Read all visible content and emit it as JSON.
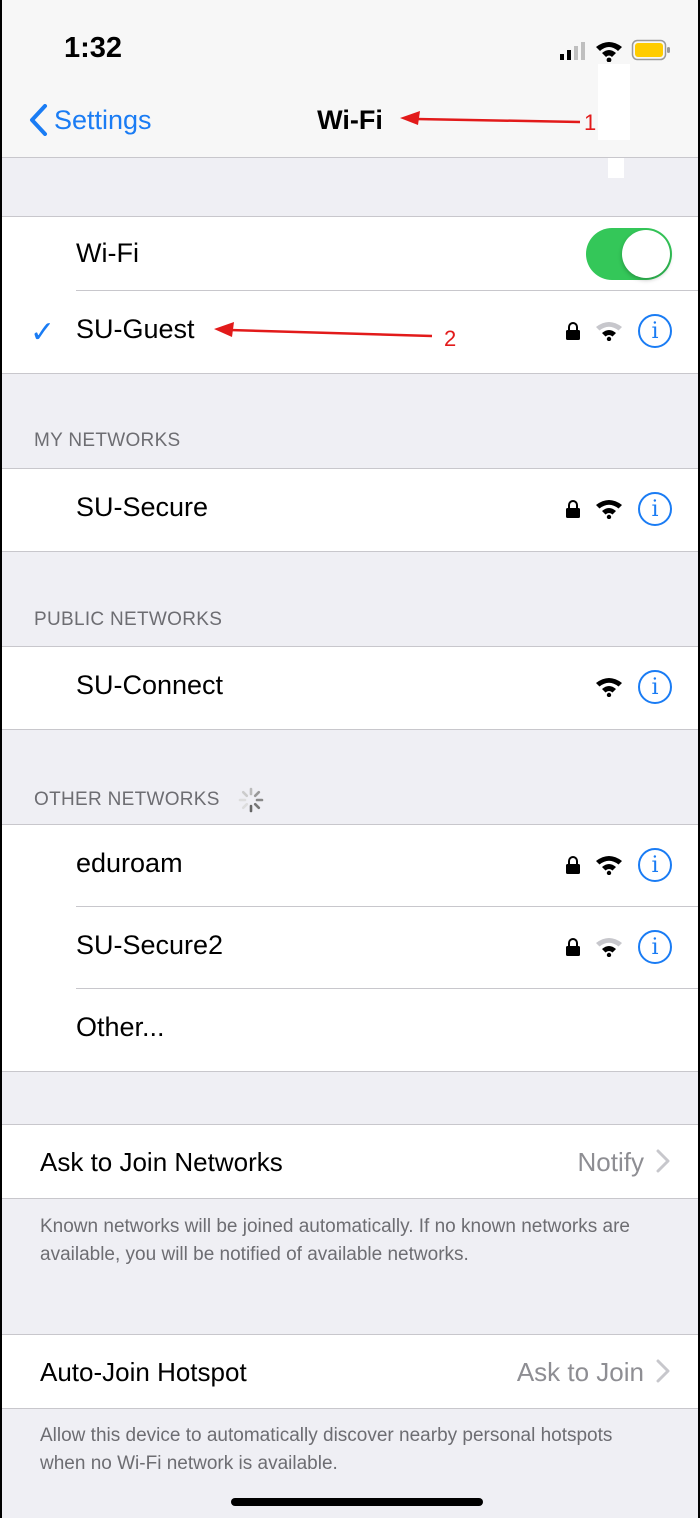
{
  "status": {
    "time": "1:32"
  },
  "nav": {
    "back_label": "Settings",
    "title": "Wi-Fi"
  },
  "wifi": {
    "label": "Wi-Fi",
    "enabled": true
  },
  "connected": {
    "name": "SU-Guest",
    "locked": true,
    "signal": "medium"
  },
  "sections": {
    "my": "MY NETWORKS",
    "public": "PUBLIC NETWORKS",
    "other": "OTHER NETWORKS"
  },
  "my_networks": [
    {
      "name": "SU-Secure",
      "locked": true,
      "signal": "full"
    }
  ],
  "public_networks": [
    {
      "name": "SU-Connect",
      "locked": false,
      "signal": "full"
    }
  ],
  "other_networks": [
    {
      "name": "eduroam",
      "locked": true,
      "signal": "full"
    },
    {
      "name": "SU-Secure2",
      "locked": true,
      "signal": "medium"
    },
    {
      "name": "Other..."
    }
  ],
  "ask_to_join": {
    "label": "Ask to Join Networks",
    "value": "Notify",
    "footer": "Known networks will be joined automatically. If no known networks are available, you will be notified of available networks."
  },
  "hotspot": {
    "label": "Auto-Join Hotspot",
    "value": "Ask to Join",
    "footer": "Allow this device to automatically discover nearby personal hotspots when no Wi-Fi network is available."
  },
  "annotations": [
    "1",
    "2"
  ],
  "colors": {
    "accent": "#1a7cf4",
    "toggle_on": "#34c759",
    "annotation": "#e21a1a"
  }
}
